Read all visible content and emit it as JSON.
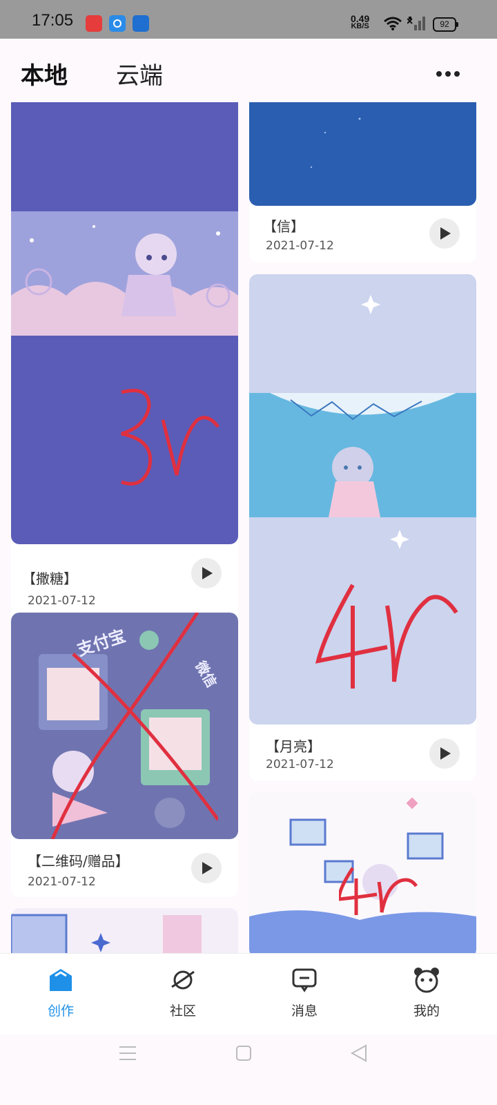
{
  "status": {
    "time": "17:05",
    "speed_value": "0.49",
    "speed_unit": "KB/S",
    "battery": "92"
  },
  "header": {
    "tabs": [
      "本地",
      "云端"
    ]
  },
  "cards": [
    {
      "title": "【撒糖】",
      "date": "2021-07-12",
      "note": "3r"
    },
    {
      "title": "【二维码/赠品】",
      "date": "2021-07-12",
      "note": "支付宝",
      "note2": "微信"
    },
    {
      "title": "【信】",
      "date": "2021-07-12"
    },
    {
      "title": "【月亮】",
      "date": "2021-07-12",
      "note": "4r"
    },
    {
      "title": "",
      "date": "",
      "note": "4r"
    }
  ],
  "nav": {
    "items": [
      "创作",
      "社区",
      "消息",
      "我的"
    ],
    "active": "创作"
  },
  "colors": {
    "accent": "#1e90e8",
    "scribble": "#e03040"
  }
}
